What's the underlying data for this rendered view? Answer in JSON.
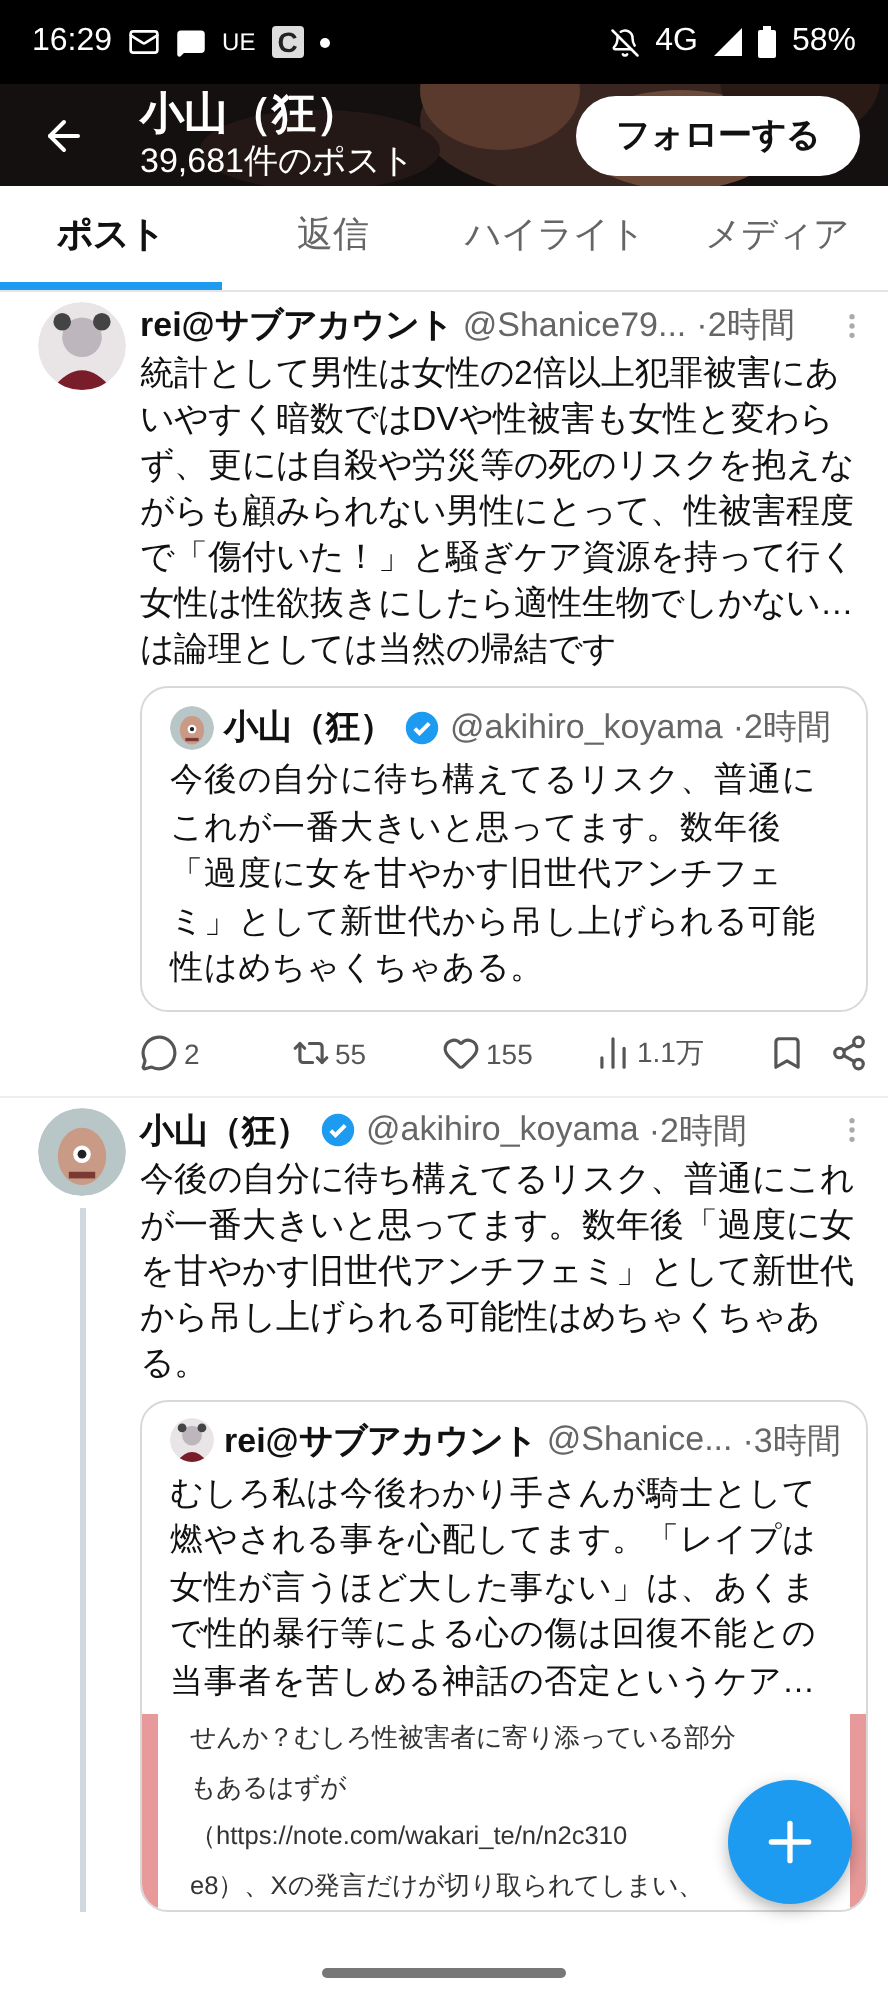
{
  "status_bar": {
    "time": "16:29",
    "app_labels": [
      "UE",
      "C"
    ],
    "network": "4G",
    "battery": "58%"
  },
  "header": {
    "title": "小山（狂）",
    "subtitle": "39,681件のポスト",
    "follow_button": "フォローする"
  },
  "tabs": [
    {
      "label": "ポスト",
      "selected": true
    },
    {
      "label": "返信",
      "selected": false
    },
    {
      "label": "ハイライト",
      "selected": false
    },
    {
      "label": "メディア",
      "selected": false
    }
  ],
  "posts": [
    {
      "name": "rei@サブアカウント",
      "verified": false,
      "handle": "@Shanice79...",
      "time": "·2時間",
      "text": "統計として男性は女性の2倍以上犯罪被害にあいやすく暗数ではDVや性被害も女性と変わらず、更には自殺や労災等の死のリスクを抱えながらも顧みられない男性にとって、性被害程度で「傷付いた！」と騒ぎケア資源を持って行く女性は性欲抜きにしたら適性生物でしかない…は論理としては当然の帰結です",
      "thread_line": false,
      "quote": {
        "name": "小山（狂）",
        "verified": true,
        "handle": "@akihiro_koyama",
        "time": "·2時間",
        "text": "今後の自分に待ち構えてるリスク、普通にこれが一番大きいと思ってます。数年後「過度に女を甘やかす旧世代アンチフェミ」として新世代から吊し上げられる可能性はめちゃくちゃある。"
      },
      "actions": [
        {
          "kind": "reply",
          "count": "2"
        },
        {
          "kind": "repost",
          "count": "55"
        },
        {
          "kind": "like",
          "count": "155"
        },
        {
          "kind": "views",
          "count": "1.1万"
        },
        {
          "kind": "bookmark"
        },
        {
          "kind": "share"
        }
      ]
    },
    {
      "name": "小山（狂）",
      "verified": true,
      "handle": "@akihiro_koyama",
      "time": "·2時間",
      "text": "今後の自分に待ち構えてるリスク、普通にこれが一番大きいと思ってます。数年後「過度に女を甘やかす旧世代アンチフェミ」として新世代から吊し上げられる可能性はめちゃくちゃある。",
      "thread_line": true,
      "quote": {
        "name": "rei@サブアカウント",
        "verified": false,
        "handle": "@Shanice...",
        "time": "·3時間",
        "text": "むしろ私は今後わかり手さんが騎士として燃やされる事を心配してます。「レイプは女性が言うほど大した事ない」は、あくまで性的暴行等による心の傷は回復不能との当事者を苦しめる神話の否定というケア…",
        "attachment": {
          "kind": "document",
          "lines": [
            "せんか？むしろ性被害者に寄り添っている部分",
            "もあるはずが",
            "（https://note.com/wakari_te/n/n2c310",
            "e8）、Xの発言だけが切り取られてしまい、"
          ]
        }
      }
    }
  ]
}
